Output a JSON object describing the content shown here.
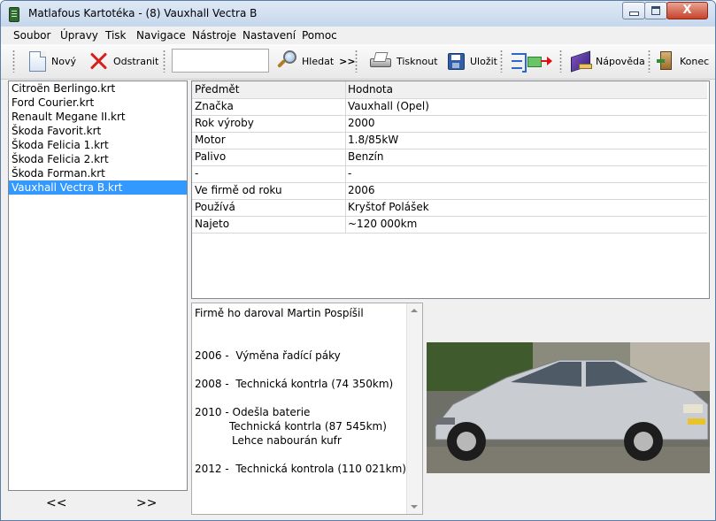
{
  "window": {
    "title": "Matlafous Kartotéka - (8) Vauxhall Vectra B",
    "close_glyph": "X"
  },
  "menu": [
    "Soubor",
    "Úpravy",
    "Tisk",
    "Navigace",
    "Nástroje",
    "Nastavení",
    "Pomoc"
  ],
  "toolbar": {
    "new_label": "Nový",
    "delete_label": "Odstranit",
    "search_value": "",
    "search_label": "Hledat",
    "search_arrows": ">>",
    "print_label": "Tisknout",
    "save_label": "Uložit",
    "help_label": "Nápověda",
    "exit_label": "Konec"
  },
  "files": [
    "Citroën Berlingo.krt",
    "Ford Courier.krt",
    "Renault Megane II.krt",
    "Škoda Favorit.krt",
    "Škoda Felicia 1.krt",
    "Škoda Felicia 2.krt",
    "Škoda Forman.krt",
    "Vauxhall Vectra B.krt"
  ],
  "selected_file": "Vauxhall Vectra B.krt",
  "nav": {
    "prev": "<<",
    "next": ">>"
  },
  "grid": {
    "headers": {
      "key": "Předmět",
      "value": "Hodnota"
    },
    "rows": [
      {
        "key": "Značka",
        "value": "Vauxhall (Opel)"
      },
      {
        "key": "Rok výroby",
        "value": "2000"
      },
      {
        "key": "Motor",
        "value": "1.8/85kW"
      },
      {
        "key": "Palivo",
        "value": "Benzín"
      },
      {
        "key": "-",
        "value": "-"
      },
      {
        "key": "Ve firmě od roku",
        "value": "2006"
      },
      {
        "key": "Používá",
        "value": "Kryštof Polášek"
      },
      {
        "key": "Najeto",
        "value": "~120 000km"
      }
    ]
  },
  "notes": {
    "line1": "Firmě ho daroval Martin Pospíšil",
    "line2": "2006 -  Výměna řadící páky",
    "line3": "2008 -  Technická kontrla (74 350km)",
    "line4": "2010 - Odešla baterie",
    "line5": "Technická kontrla (87 545km)",
    "line6": "Lehce nabourán kufr",
    "line7": "2012 -  Technická kontrola (110 021km)"
  },
  "colors": {
    "selection": "#3399ff",
    "car_body": "#c9ccd0"
  }
}
